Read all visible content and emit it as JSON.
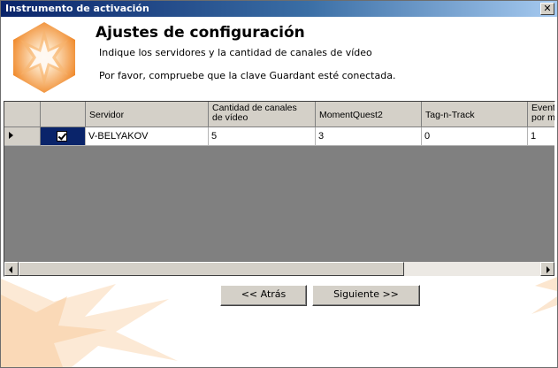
{
  "window": {
    "title": "Instrumento de activación",
    "close_glyph": "✕"
  },
  "header": {
    "title": "Ajustes de configuración",
    "subtitle": "Indique los servidores y la cantidad de canales de vídeo",
    "notice": "Por favor, compruebe que la clave Guardant esté conectada.",
    "logo_icon": "orange-star-logo-icon"
  },
  "grid": {
    "columns": [
      {
        "label": ""
      },
      {
        "label": ""
      },
      {
        "label": "Servidor"
      },
      {
        "label": "Cantidad de canales\nde vídeo"
      },
      {
        "label": "MomentQuest2"
      },
      {
        "label": "Tag-n-Track"
      },
      {
        "label": "Event\npor m"
      }
    ],
    "rows": [
      {
        "checked": true,
        "server": "V-BELYAKOV",
        "video_channels": "5",
        "momentquest2": "3",
        "tag_n_track": "0",
        "event": "1"
      }
    ]
  },
  "buttons": {
    "back": "<< Atrás",
    "next": "Siguiente >>"
  },
  "colors": {
    "title_bar": "#0a246a",
    "accent_orange": "#f08a2c",
    "grid_empty": "#808080",
    "selection": "#0a246a"
  }
}
